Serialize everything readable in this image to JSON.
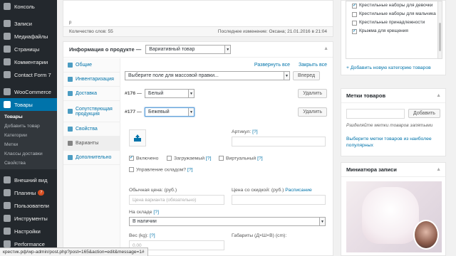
{
  "sidebar": {
    "items": [
      {
        "label": "Консоль",
        "icon": "dashboard-icon"
      },
      {
        "label": "Записи",
        "icon": "pin-icon"
      },
      {
        "label": "Медиафайлы",
        "icon": "media-icon"
      },
      {
        "label": "Страницы",
        "icon": "page-icon"
      },
      {
        "label": "Комментарии",
        "icon": "comment-icon"
      },
      {
        "label": "Contact Form 7",
        "icon": "mail-icon"
      },
      {
        "label": "WooCommerce",
        "icon": "woocommerce-icon"
      },
      {
        "label": "Товары",
        "icon": "products-icon"
      }
    ],
    "submenu": [
      "Товары",
      "Добавить товар",
      "Категории",
      "Метки",
      "Классы доставки",
      "Свойства"
    ],
    "lower": [
      {
        "label": "Внешний вид",
        "icon": "brush-icon"
      },
      {
        "label": "Плагины",
        "icon": "plugin-icon",
        "badge": "7"
      },
      {
        "label": "Пользователи",
        "icon": "users-icon"
      },
      {
        "label": "Инструменты",
        "icon": "tools-icon"
      },
      {
        "label": "Настройки",
        "icon": "settings-icon"
      },
      {
        "label": "Performance",
        "icon": "performance-icon"
      }
    ]
  },
  "editor": {
    "paragraph_tag": "p",
    "word_count": "Количество слов: 55",
    "last_edited": "Последнее изменение: Оксана; 21.01.2016 в 21:04"
  },
  "product": {
    "title": "Информация о продукте —",
    "type_value": "Вариативный товар",
    "tabs": [
      "Общие",
      "Инвентаризация",
      "Доставка",
      "Сопутствующая продукция",
      "Свойства",
      "Варианты",
      "Дополнительно"
    ],
    "expand_all": "Развернуть все",
    "collapse_all": "Закрыть все",
    "bulk_select": "Выберите поле для массовой правки...",
    "go_button": "Вперед",
    "variations": [
      {
        "id": "#176 —",
        "value": "Белый",
        "remove": "Удалить"
      },
      {
        "id": "#177 —",
        "value": "Бежевый",
        "remove": "Удалить"
      }
    ],
    "sku_label": "Артикул:",
    "help_mark": "[?]",
    "enabled_label": "Включено",
    "downloadable_label": "Загружаемый",
    "virtual_label": "Виртуальный",
    "manage_stock_label": "Управление складом?",
    "regular_price_label": "Обычная цена: (руб.)",
    "regular_price_placeholder": "Цена варианта (обязательно)",
    "sale_price_label": "Цена со скидкой: (руб.)",
    "schedule_link": "Расписание",
    "stock_label": "На складе",
    "stock_value": "В наличии",
    "weight_label": "Вес (kg):",
    "weight_placeholder": "0.00",
    "dimensions_label": "Габариты (Д×Ш×В) (cm):"
  },
  "categories": {
    "items": [
      {
        "label": "Крестильные наборы для девочки",
        "checked": true
      },
      {
        "label": "Крестильные наборы для мальчика",
        "checked": false
      },
      {
        "label": "Крестильные принадлежности",
        "checked": false
      },
      {
        "label": "Крыжма для крещения",
        "checked": true
      }
    ],
    "add_link": "+ Добавить новую категорию товаров"
  },
  "tags": {
    "title": "Метки товаров",
    "add_button": "Добавить",
    "hint": "Разделяйте метки товаров запятыми",
    "popular_link": "Выберите метки товаров из наиболее популярных"
  },
  "thumbnail": {
    "title": "Миниатюра записи"
  },
  "statusbar": {
    "url": "крестик.рф/wp-admin/post.php?post=165&action=edit&message=1#"
  },
  "colors": {
    "sidebar_bg": "#23282d",
    "active_blue": "#0073aa",
    "link_blue": "#0073aa",
    "plugin_badge": "#d54e21"
  }
}
